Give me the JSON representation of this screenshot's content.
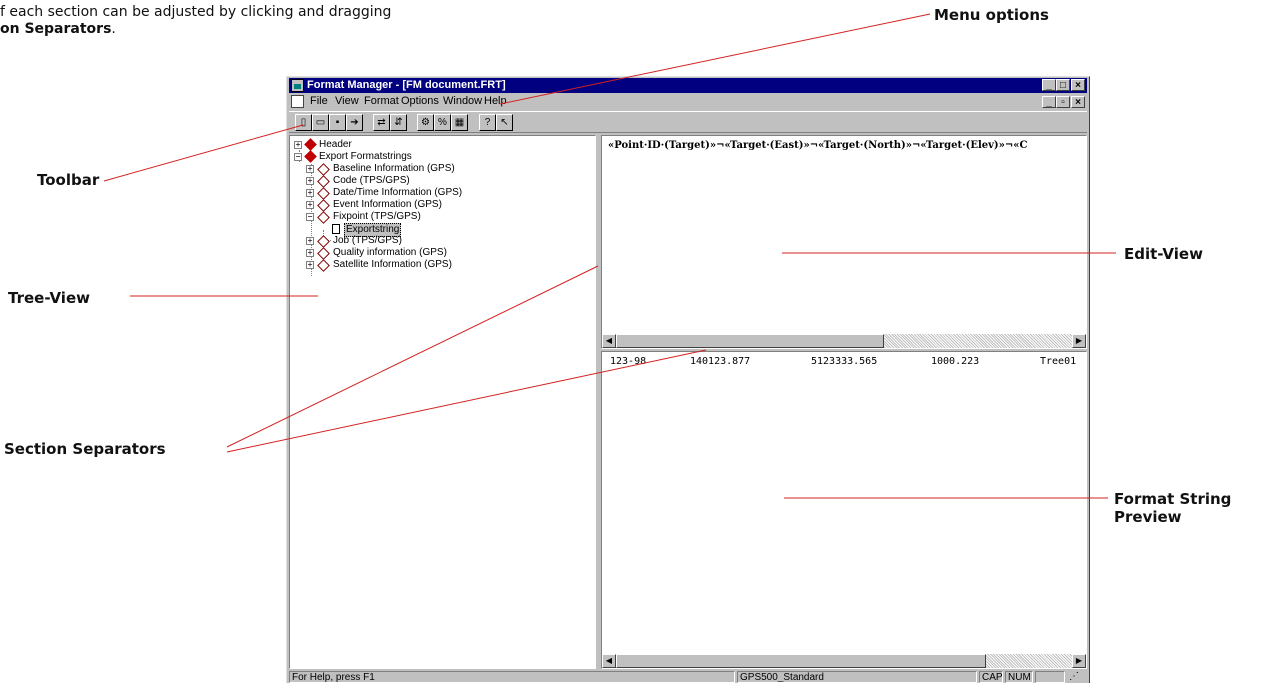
{
  "intro": {
    "line1": "f each section can be adjusted by clicking and dragging",
    "line2_bold": "on Separators",
    "line2_tail": "."
  },
  "annotations": {
    "menu_options": "Menu options",
    "toolbar": "Toolbar",
    "tree_view": "Tree-View",
    "edit_view": "Edit-View",
    "section_separators": "Section Separators",
    "format_string_line1": "Format String",
    "format_string_line2": "Preview"
  },
  "window": {
    "title": "Format Manager - [FM document.FRT]",
    "title_buttons": [
      "_",
      "□",
      "×"
    ],
    "mdi_buttons": [
      "_",
      "▫",
      "×"
    ]
  },
  "menu": [
    "File",
    "View",
    "Format",
    "Options",
    "Window",
    "Help"
  ],
  "toolbar_icons": [
    "new-icon",
    "open-icon",
    "save-icon",
    "export-icon",
    "import-icon",
    "format-icon",
    "settings-icon",
    "percent-icon",
    "properties-icon",
    "help-icon",
    "context-help-icon"
  ],
  "tree": {
    "items": [
      {
        "label": "Header",
        "expander": "+"
      },
      {
        "label": "Export Formatstrings",
        "expander": "−"
      },
      {
        "label": "Baseline Information (GPS)",
        "expander": "+"
      },
      {
        "label": "Code (TPS/GPS)",
        "expander": "+"
      },
      {
        "label": "Date/Time Information (GPS)",
        "expander": "+"
      },
      {
        "label": "Event Information (GPS)",
        "expander": "+"
      },
      {
        "label": "Fixpoint (TPS/GPS)",
        "expander": "−"
      },
      {
        "label": "Exportstring"
      },
      {
        "label": "Job (TPS/GPS)",
        "expander": "+"
      },
      {
        "label": "Quality information (GPS)",
        "expander": "+"
      },
      {
        "label": "Satellite Information (GPS)",
        "expander": "+"
      }
    ]
  },
  "edit_view": {
    "text": "«Point·ID·(Target)»¬«Target·(East)»¬«Target·(North)»¬«Target·(Elev)»¬«C"
  },
  "preview": {
    "columns": [
      "123-98",
      "140123.877",
      "5123333.565",
      "1000.223",
      "Tree01"
    ]
  },
  "statusbar": {
    "help": "For Help, press F1",
    "format": "GPS500_Standard",
    "cap": "CAP",
    "num": "NUM"
  }
}
